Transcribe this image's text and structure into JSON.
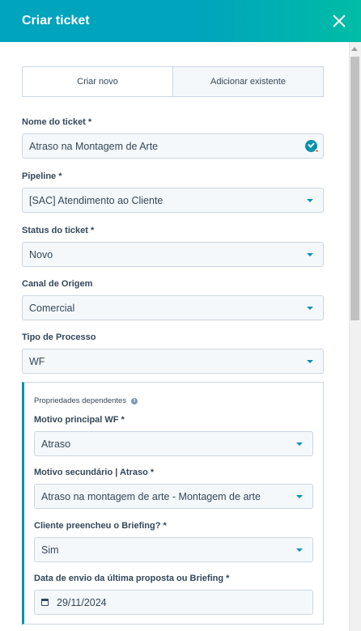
{
  "header": {
    "title": "Criar ticket"
  },
  "tabs": [
    {
      "label": "Criar novo"
    },
    {
      "label": "Adicionar existente"
    }
  ],
  "fields": {
    "nome": {
      "label": "Nome do ticket *",
      "value": "Atraso na Montagem de Arte"
    },
    "pipeline": {
      "label": "Pipeline *",
      "value": "[SAC] Atendimento ao Cliente"
    },
    "status": {
      "label": "Status do ticket *",
      "value": "Novo"
    },
    "canal": {
      "label": "Canal de Origem",
      "value": "Comercial"
    },
    "tipo": {
      "label": "Tipo de Processo",
      "value": "WF"
    }
  },
  "dependent": {
    "title": "Propriedades dependentes",
    "motivo_principal": {
      "label": "Motivo principal WF *",
      "value": "Atraso"
    },
    "motivo_secundario": {
      "label": "Motivo secundário | Atraso *",
      "value": "Atraso na montagem de arte - Montagem de arte"
    },
    "briefing": {
      "label": "Cliente preencheu o Briefing? *",
      "value": "Sim"
    },
    "data_envio": {
      "label": "Data de envio da última proposta ou Briefing *",
      "value": "29/11/2024"
    }
  },
  "colors": {
    "header_start": "#00a4bd",
    "header_end": "#00bda5",
    "accent": "#0091ae",
    "text": "#33475b",
    "input_bg": "#f5f8fa",
    "border": "#cbd6e2"
  }
}
